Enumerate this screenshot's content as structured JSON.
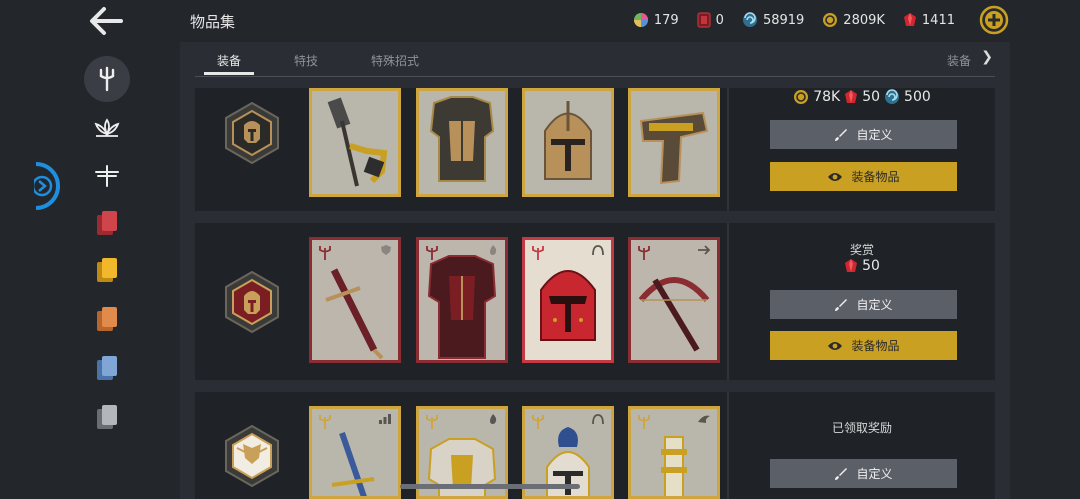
{
  "header": {
    "title": "物品集",
    "currencies": [
      {
        "icon": "color-wheel-icon",
        "value": "179"
      },
      {
        "icon": "red-card-icon",
        "value": "0"
      },
      {
        "icon": "blue-spiral-icon",
        "value": "58919"
      },
      {
        "icon": "gold-coin-icon",
        "value": "2809K"
      },
      {
        "icon": "ruby-icon",
        "value": "1411"
      }
    ]
  },
  "tabs": [
    {
      "label": "装备",
      "active": true
    },
    {
      "label": "特技",
      "active": false
    },
    {
      "label": "特殊招式",
      "active": false
    }
  ],
  "tab_right_label": "装备",
  "nav": [
    {
      "icon": "trident-icon",
      "active": true
    },
    {
      "icon": "lotus-icon",
      "active": false
    },
    {
      "icon": "dragonfly-icon",
      "active": false
    },
    {
      "icon": "red-cards-icon",
      "active": false
    },
    {
      "icon": "yellow-cards-icon",
      "active": false
    },
    {
      "icon": "orange-cards-icon",
      "active": false
    },
    {
      "icon": "blue-cards-icon",
      "active": false
    },
    {
      "icon": "gray-cards-icon",
      "active": false
    }
  ],
  "sets": [
    {
      "emblem": "helmet-hex-emblem",
      "rarity": "gold",
      "items": [
        "hammer-weapon",
        "armor-body",
        "helmet-head",
        "ranged-gun"
      ],
      "cost": {
        "coins": "78K",
        "rubies": "50",
        "spirals": "500"
      },
      "customize_label": "自定义",
      "equip_label": "装备物品"
    },
    {
      "emblem": "spartan-hex-emblem",
      "rarity": "red",
      "items": [
        "sword-weapon",
        "armor-body",
        "helmet-head",
        "crossbow-ranged"
      ],
      "reward_label": "奖赏",
      "reward_rubies": "50",
      "customize_label": "自定义",
      "equip_label": "装备物品"
    },
    {
      "emblem": "winged-hex-emblem",
      "rarity": "gold",
      "items": [
        "sword-weapon",
        "armor-body",
        "helmet-head",
        "launcher-ranged"
      ],
      "status_label": "已领取奖励",
      "customize_label": "自定义"
    }
  ],
  "colors": {
    "background": "#23272c",
    "gold": "#c9a022",
    "red_frame": "#8a2d33",
    "accent_blue": "#1e90ff"
  }
}
